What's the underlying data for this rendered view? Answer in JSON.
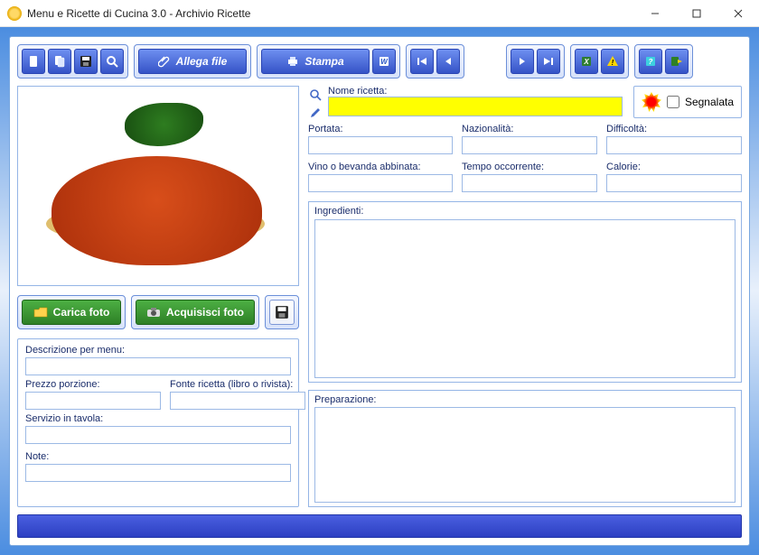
{
  "window": {
    "title": "Menu e Ricette di Cucina 3.0 - Archivio Ricette"
  },
  "toolbar": {
    "attach_label": "Allega file",
    "print_label": "Stampa"
  },
  "photo_actions": {
    "load_label": "Carica foto",
    "acquire_label": "Acquisisci foto"
  },
  "left_fields": {
    "desc_label": "Descrizione per menu:",
    "price_label": "Prezzo porzione:",
    "source_label": "Fonte ricetta (libro o rivista):",
    "service_label": "Servizio in tavola:",
    "note_label": "Note:",
    "desc": "",
    "price": "",
    "source": "",
    "service": "",
    "note": ""
  },
  "right_fields": {
    "name_label": "Nome ricetta:",
    "name": "",
    "segnalata_label": "Segnalata",
    "portata_label": "Portata:",
    "nazionalita_label": "Nazionalità:",
    "difficolta_label": "Difficoltà:",
    "vino_label": "Vino o bevanda abbinata:",
    "tempo_label": "Tempo occorrente:",
    "calorie_label": "Calorie:",
    "ingredienti_label": "Ingredienti:",
    "preparazione_label": "Preparazione:",
    "portata": "",
    "nazionalita": "",
    "difficolta": "",
    "vino": "",
    "tempo": "",
    "calorie": "",
    "ingredienti": "",
    "preparazione": ""
  }
}
